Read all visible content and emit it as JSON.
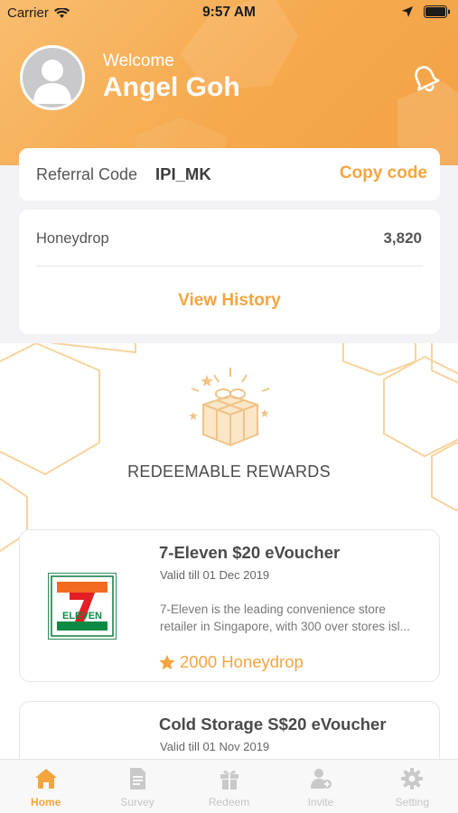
{
  "status_bar": {
    "carrier": "Carrier",
    "time": "9:57 AM"
  },
  "profile": {
    "welcome": "Welcome",
    "name": "Angel Goh"
  },
  "referral": {
    "label": "Referral Code",
    "code": "IPI_MK",
    "copy_label": "Copy code"
  },
  "honeydrop": {
    "label": "Honeydrop",
    "value": "3,820",
    "history_label": "View History"
  },
  "rewards": {
    "title": "REDEEMABLE REWARDS",
    "items": [
      {
        "title": "7-Eleven $20 eVoucher",
        "valid": "Valid till 01 Dec 2019",
        "desc_line1": "7-Eleven is the leading convenience store",
        "desc_line2": "retailer in Singapore, with 300 over stores isl...",
        "points": "2000 Honeydrop",
        "logo_text": "ELEVEN"
      },
      {
        "title": "Cold Storage S$20 eVoucher",
        "valid": "Valid till 01 Nov 2019"
      }
    ]
  },
  "tabs": [
    {
      "label": "Home",
      "icon": "home-icon",
      "active": true
    },
    {
      "label": "Survey",
      "icon": "document-icon"
    },
    {
      "label": "Redeem",
      "icon": "gift-icon"
    },
    {
      "label": "Invite",
      "icon": "user-add-icon"
    },
    {
      "label": "Setting",
      "icon": "gear-icon"
    }
  ],
  "colors": {
    "accent": "#f4a540",
    "header": "#f6a94d",
    "inactive_tab": "#c5c5c5"
  }
}
